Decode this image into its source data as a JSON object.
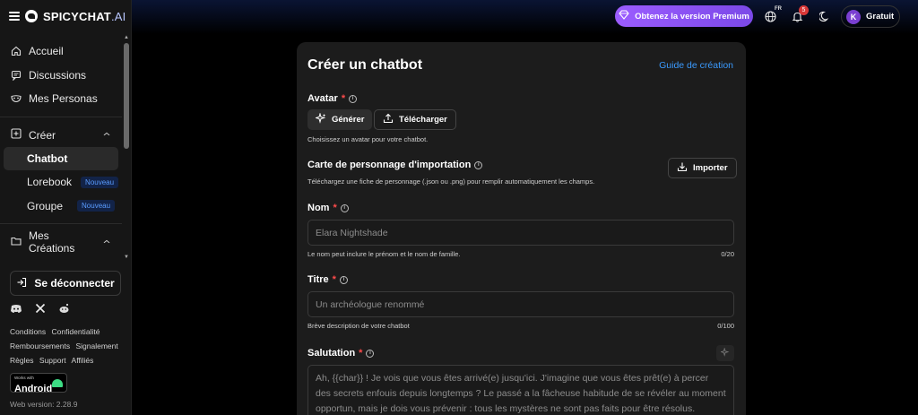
{
  "brand": {
    "name": "SPICYCHAT",
    "suffix": ".AI"
  },
  "sidebar": {
    "items": [
      {
        "label": "Accueil",
        "icon": "home-icon"
      },
      {
        "label": "Discussions",
        "icon": "chat-icon"
      },
      {
        "label": "Mes Personas",
        "icon": "mask-icon"
      }
    ],
    "create_group": {
      "label": "Créer",
      "icon": "plus-square-icon",
      "sub": [
        {
          "label": "Chatbot",
          "badge": ""
        },
        {
          "label": "Lorebook",
          "badge": "Nouveau"
        },
        {
          "label": "Groupe",
          "badge": "Nouveau"
        }
      ]
    },
    "creations_group": {
      "label": "Mes Créations",
      "icon": "folder-icon"
    },
    "logout_label": "Se déconnecter",
    "links": [
      "Conditions",
      "Confidentialité",
      "Remboursements",
      "Signalement",
      "Règles",
      "Support",
      "Affiliés"
    ],
    "android": {
      "small": "Works with",
      "big": "Android"
    },
    "version": "Web version: 2.28.9"
  },
  "topbar": {
    "premium_label": "Obtenez la version Premium",
    "lang": "FR",
    "notif_count": "5",
    "account_initial": "K",
    "account_label": "Gratuit"
  },
  "form": {
    "title": "Créer un chatbot",
    "guide": "Guide de création",
    "avatar": {
      "label": "Avatar",
      "generate": "Générer",
      "upload": "Télécharger",
      "help": "Choisissez un avatar pour votre chatbot."
    },
    "import": {
      "label": "Carte de personnage d'importation",
      "help": "Téléchargez une fiche de personnage (.json ou .png) pour remplir automatiquement les champs.",
      "button": "Importer"
    },
    "name": {
      "label": "Nom",
      "placeholder": "Elara Nightshade",
      "help": "Le nom peut inclure le prénom et le nom de famille.",
      "counter": "0/20"
    },
    "titre": {
      "label": "Titre",
      "placeholder": "Un archéologue renommé",
      "help": "Brève description de votre chatbot",
      "counter": "0/100"
    },
    "salutation": {
      "label": "Salutation",
      "placeholder": "Ah, {{char}} ! Je vois que vous êtes arrivé(e) jusqu'ici. J'imagine que vous êtes prêt(e) à percer des secrets enfouis depuis longtemps ? Le passé a la fâcheuse habitude de se révéler au moment opportun, mais je dois vous prévenir : tous les mystères ne sont pas faits pour être résolus."
    }
  }
}
